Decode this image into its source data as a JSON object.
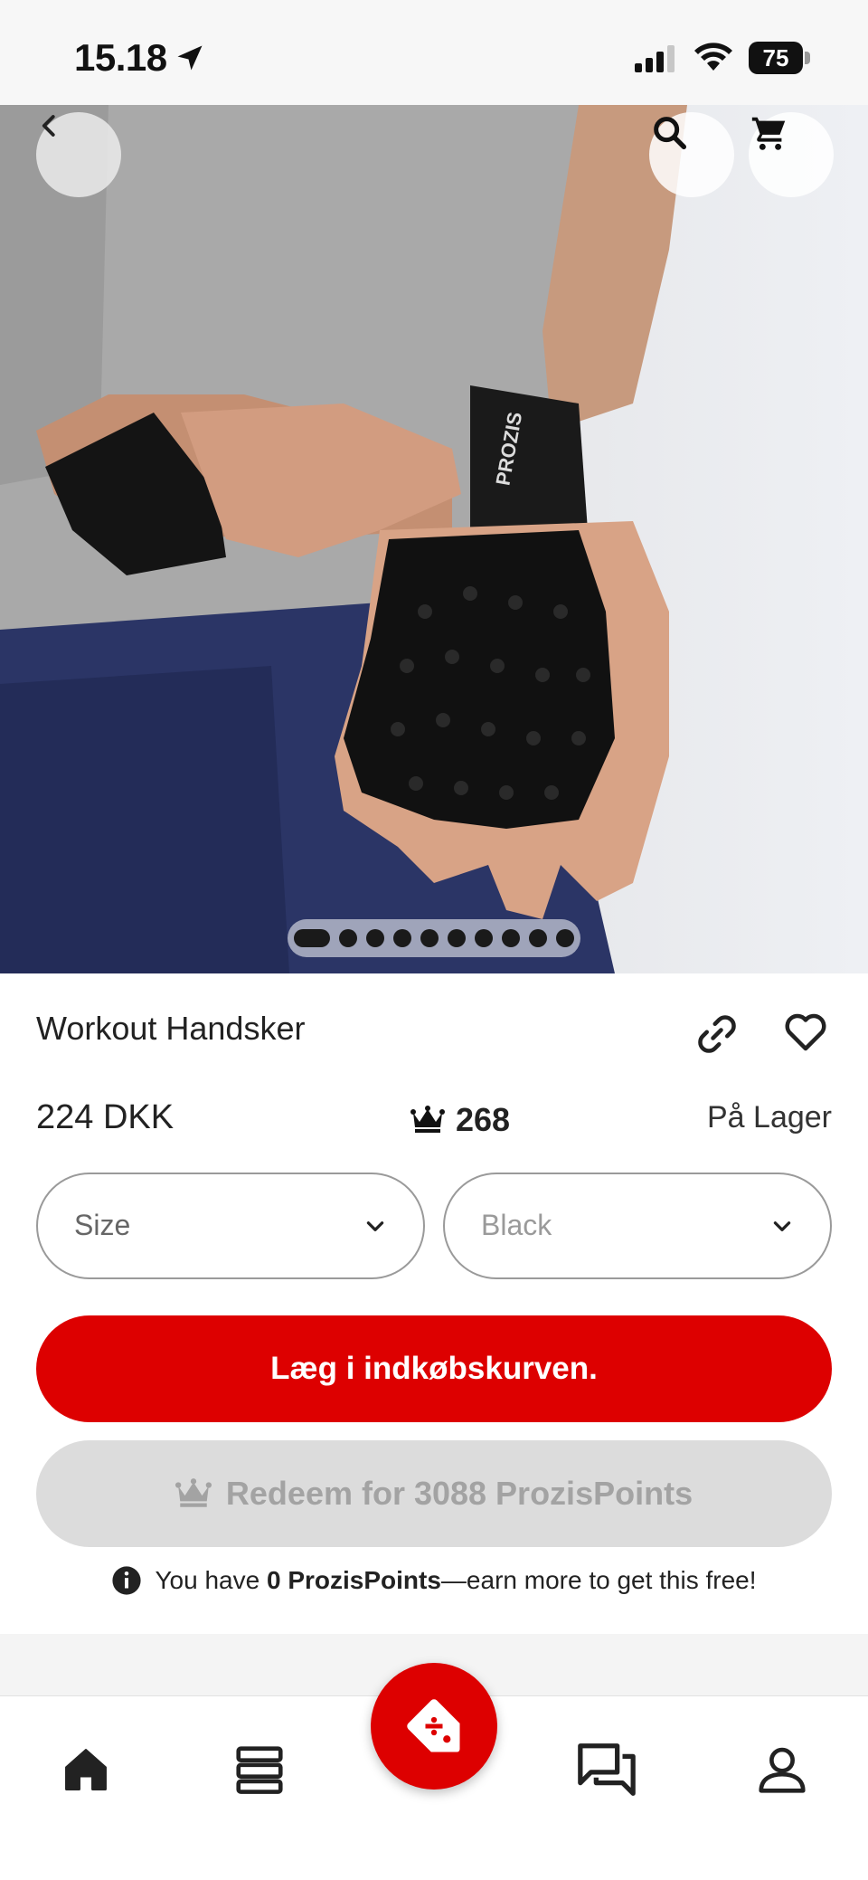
{
  "status_bar": {
    "time": "15.18",
    "battery": "75"
  },
  "hero": {
    "image": "workout glove product photo",
    "brand_imprint": "PROZIS",
    "pager": {
      "total": 10,
      "active_index": 0
    }
  },
  "header_actions": {
    "back_icon": "chevron-left-icon",
    "search_icon": "search-icon",
    "cart_icon": "cart-icon"
  },
  "product": {
    "title": "Workout Handsker",
    "price": "224 DKK",
    "points": "268",
    "stock": "På Lager"
  },
  "options": {
    "size": "Size",
    "color": "Black"
  },
  "actions": {
    "add_to_cart": "Læg i indkøbskurven.",
    "redeem": "Redeem for 3088 ProzisPoints"
  },
  "points_note": {
    "prefix": "You have ",
    "bold": "0 ProzisPoints",
    "suffix": "—earn more to get this free!"
  },
  "colors": {
    "accent_red": "#dd0000",
    "disabled_gray": "#dcdcdc"
  },
  "bottom_nav": {
    "items": [
      "home-icon",
      "catalog-icon",
      "deals-icon",
      "chat-icon",
      "profile-icon"
    ]
  }
}
